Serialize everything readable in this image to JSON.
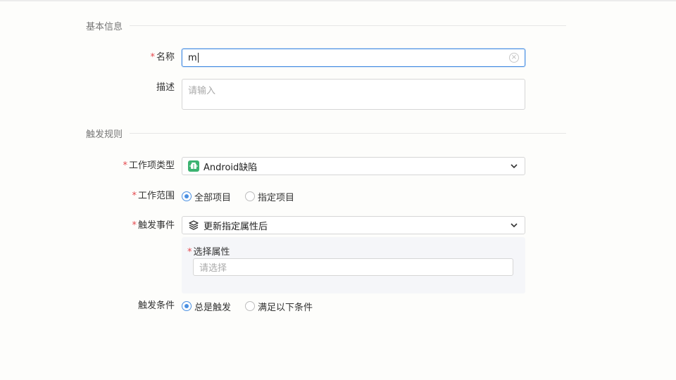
{
  "sections": {
    "basic_info": "基本信息",
    "trigger_rules": "触发规则"
  },
  "fields": {
    "name": {
      "label": "名称",
      "value": "m",
      "required_mark": "*"
    },
    "description": {
      "label": "描述",
      "placeholder": "请输入"
    },
    "work_item_type": {
      "label": "工作项类型",
      "value": "Android缺陷",
      "required_mark": "*",
      "icon": "android-bug-icon"
    },
    "work_scope": {
      "label": "工作范围",
      "required_mark": "*",
      "options": [
        "全部项目",
        "指定项目"
      ],
      "selected": "全部项目"
    },
    "trigger_event": {
      "label": "触发事件",
      "value": "更新指定属性后",
      "required_mark": "*",
      "icon": "layers-icon",
      "sub": {
        "label": "选择属性",
        "required_mark": "*",
        "placeholder": "请选择"
      }
    },
    "trigger_condition": {
      "label": "触发条件",
      "options": [
        "总是触发",
        "满足以下条件"
      ],
      "selected": "总是触发"
    }
  },
  "colors": {
    "accent": "#4a90e2",
    "required": "#e5484d",
    "icon_green": "#3cb371"
  }
}
